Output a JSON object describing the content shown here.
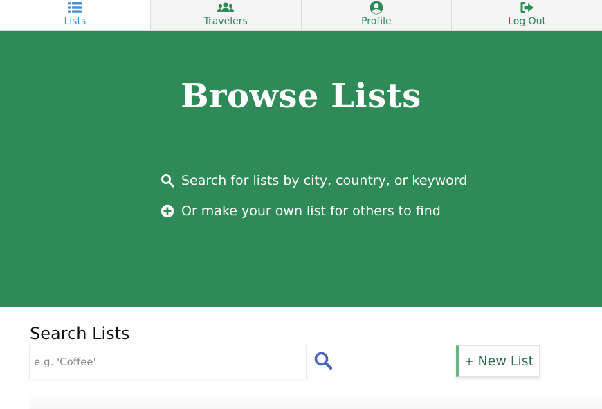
{
  "nav": {
    "items": [
      {
        "label": "Lists",
        "icon": "list-icon",
        "active": true
      },
      {
        "label": "Travelers",
        "icon": "users-icon",
        "active": false
      },
      {
        "label": "Profile",
        "icon": "user-circle-icon",
        "active": false
      },
      {
        "label": "Log Out",
        "icon": "sign-out-icon",
        "active": false
      }
    ]
  },
  "hero": {
    "title": "Browse Lists",
    "lines": [
      {
        "icon": "search-icon",
        "text": "Search for lists by city, country, or keyword"
      },
      {
        "icon": "plus-circle-icon",
        "text": "Or make your own list for others to find"
      }
    ]
  },
  "search": {
    "heading": "Search Lists",
    "placeholder": "e.g. 'Coffee'",
    "value": "",
    "button_icon": "search-icon"
  },
  "new_list": {
    "plus": "+",
    "label": "New List"
  },
  "colors": {
    "brand_green": "#2e8b57",
    "active_blue": "#4a90d9",
    "search_icon_blue": "#4a66c4"
  }
}
